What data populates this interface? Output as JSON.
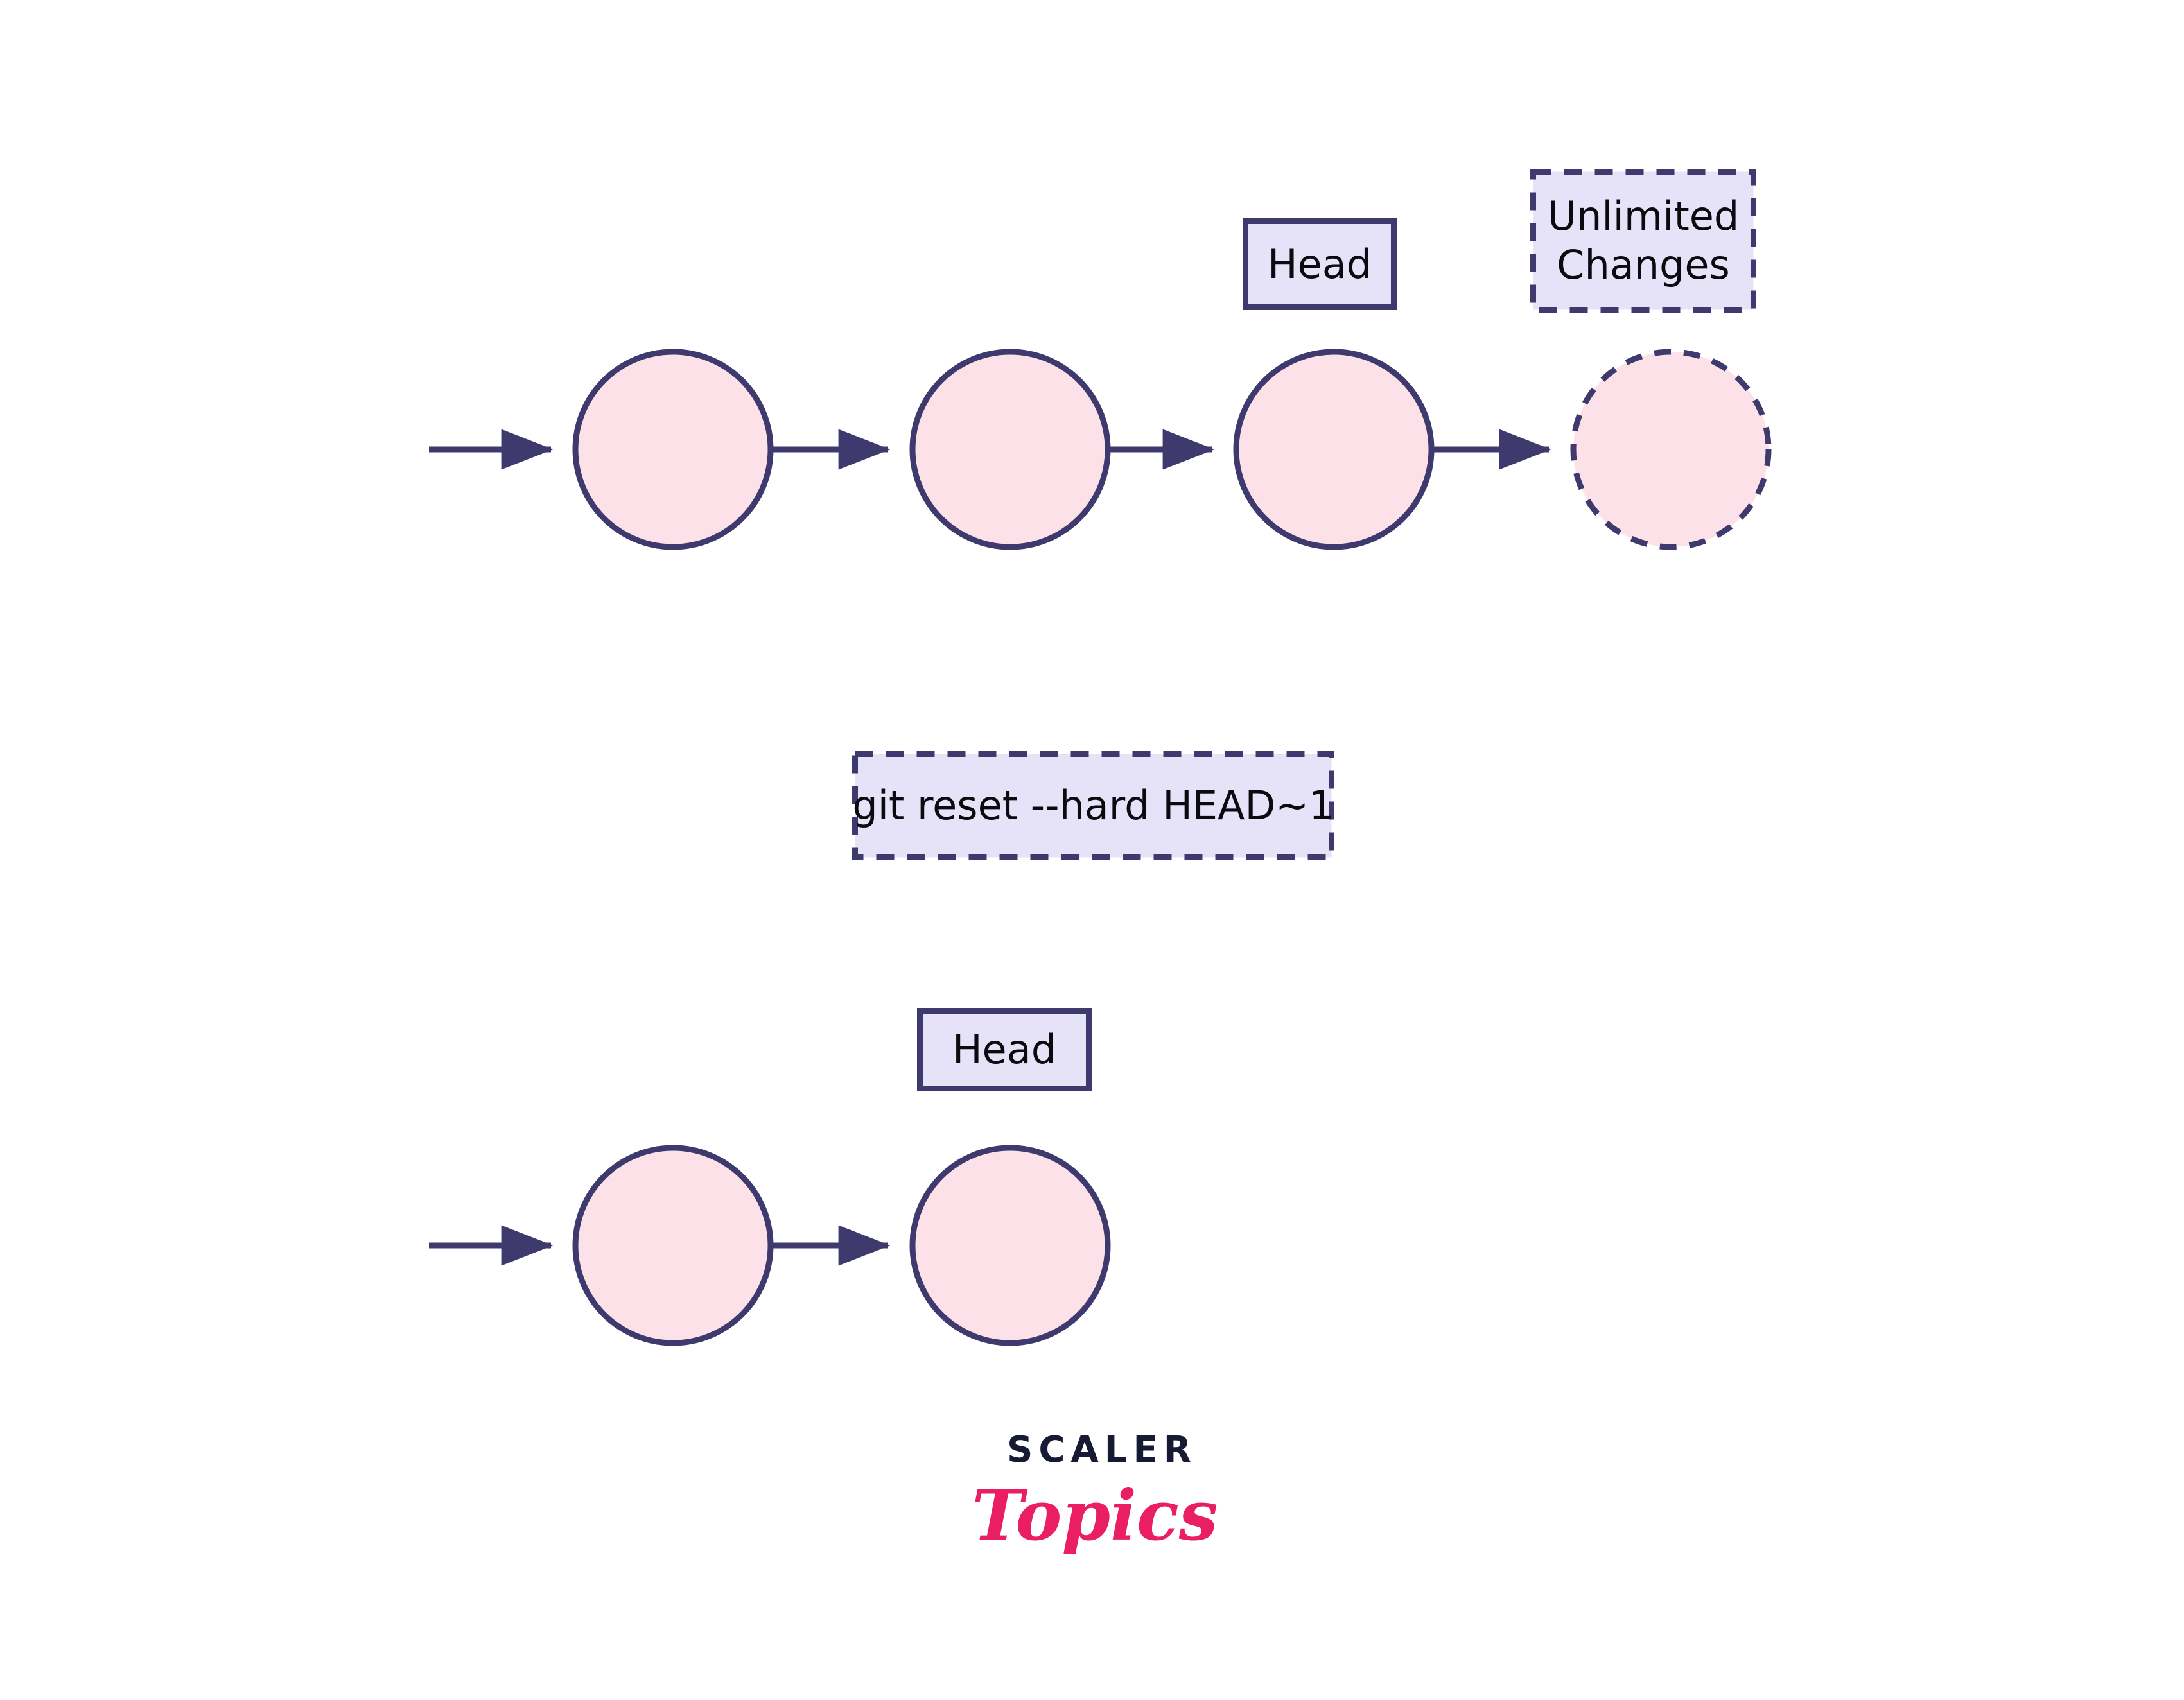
{
  "diagram": {
    "title": "git reset --hard HEAD~1 commit history",
    "background_color": "#ffffff",
    "stroke_color": "#3e3a6e",
    "commit_fill": "#fde1e9",
    "box_fill": "#e6e3f8",
    "text_color": "#0b0b0f",
    "before": {
      "head_label": "Head",
      "unlimited_changes_label": "Unlimited\nChanges",
      "commits": [
        {
          "id": "c1",
          "style": "solid"
        },
        {
          "id": "c2",
          "style": "solid"
        },
        {
          "id": "c3",
          "style": "solid"
        },
        {
          "id": "c4",
          "style": "dashed"
        }
      ]
    },
    "command": {
      "text": "git reset --hard HEAD~1",
      "border_style": "dashed"
    },
    "after": {
      "head_label": "Head",
      "commits": [
        {
          "id": "c1",
          "style": "solid"
        },
        {
          "id": "c2",
          "style": "solid"
        }
      ]
    }
  },
  "branding": {
    "wordmark": "SCALER",
    "script": "Topics",
    "wordmark_color": "#161a33",
    "script_color": "#e91e63"
  }
}
